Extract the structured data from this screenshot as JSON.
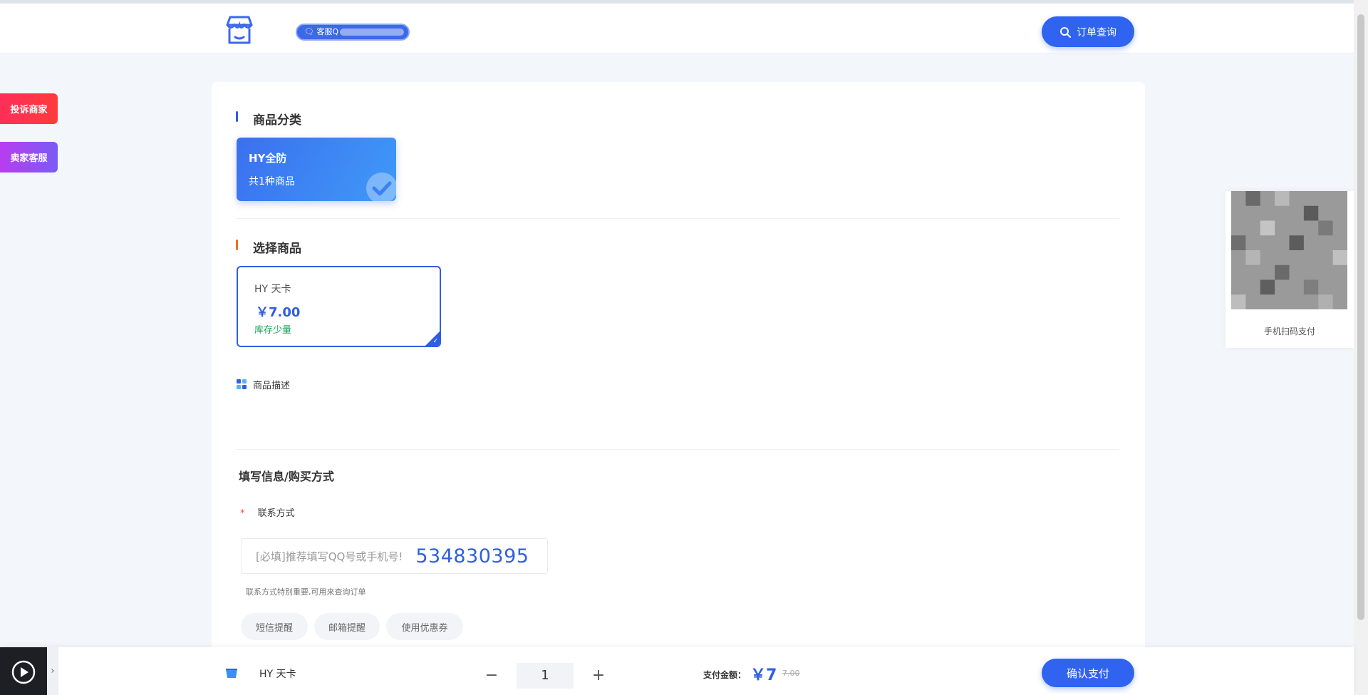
{
  "header": {
    "cs_label": "客服Q",
    "order_query_label": "订单查询"
  },
  "side_buttons": {
    "complain": "投诉商家",
    "seller_service": "卖家客服"
  },
  "category_section": {
    "title": "商品分类",
    "card": {
      "name": "HY全防",
      "count": "共1种商品"
    }
  },
  "product_section": {
    "title": "选择商品",
    "card": {
      "name": "HY 天卡",
      "price": "￥7.00",
      "stock": "库存少量"
    }
  },
  "description": {
    "label": "商品描述"
  },
  "form": {
    "title": "填写信息/购买方式",
    "required_mark": "*",
    "contact_label": "联系方式",
    "contact_placeholder": "[必填]推荐填写QQ号或手机号!",
    "contact_value": "534830395",
    "contact_hint": "联系方式特别重要,可用来查询订单",
    "options": [
      "短信提醒",
      "邮箱提醒",
      "使用优惠券"
    ]
  },
  "qr": {
    "caption": "手机扫码支付"
  },
  "bottom_bar": {
    "product_name": "HY 天卡",
    "qty_minus": "−",
    "quantity": "1",
    "qty_plus": "+",
    "pay_label": "支付金额：",
    "pay_amount": "￥7",
    "pay_original": "7.00",
    "confirm_label": "确认支付"
  },
  "colors": {
    "accent": "#2f63f0",
    "complain": "#ff2f59",
    "seller": "#9a4cf2",
    "stock": "#18a058"
  }
}
